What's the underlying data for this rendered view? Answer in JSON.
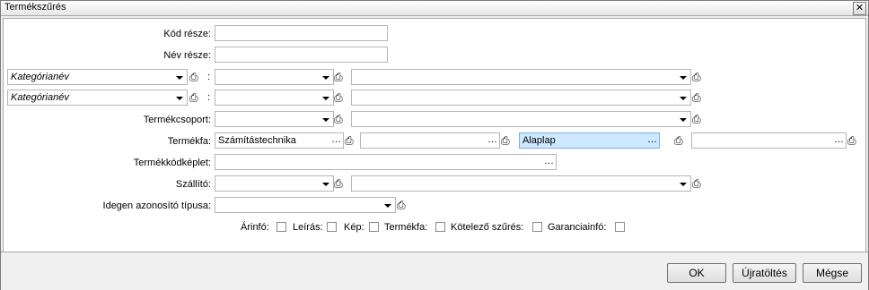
{
  "window": {
    "title": "Termékszűrés",
    "close_glyph": "✕"
  },
  "fields": {
    "kod_label": "Kód része:",
    "nev_label": "Név része:",
    "cat1_label": "Kategórianév",
    "cat2_label": "Kategórianév",
    "colon": ":",
    "termekcsoport_label": "Termékcsoport:",
    "termekfa_label": "Termékfa:",
    "termekfa_value_1": "Számítástechnika",
    "termekfa_value_2": "",
    "termekfa_value_3": "Alaplap",
    "termekfa_value_4": "",
    "termekkodkeplet_label": "Termékkódképlet:",
    "szallito_label": "Szállító:",
    "idegen_label": "Idegen azonosító típusa:"
  },
  "checkboxes": {
    "arinfo": "Árinfó:",
    "leiras": "Leírás:",
    "kep": "Kép:",
    "termekfa": "Termékfa:",
    "kotelezo": "Kötelező szűrés:",
    "garancia": "Garanciainfó:"
  },
  "buttons": {
    "ok": "OK",
    "reload": "Újratöltés",
    "cancel": "Mégse"
  },
  "icons": {
    "attach": "paperclip-icon",
    "browse": "ellipsis-icon",
    "dropdown": "chevron-down-icon"
  }
}
